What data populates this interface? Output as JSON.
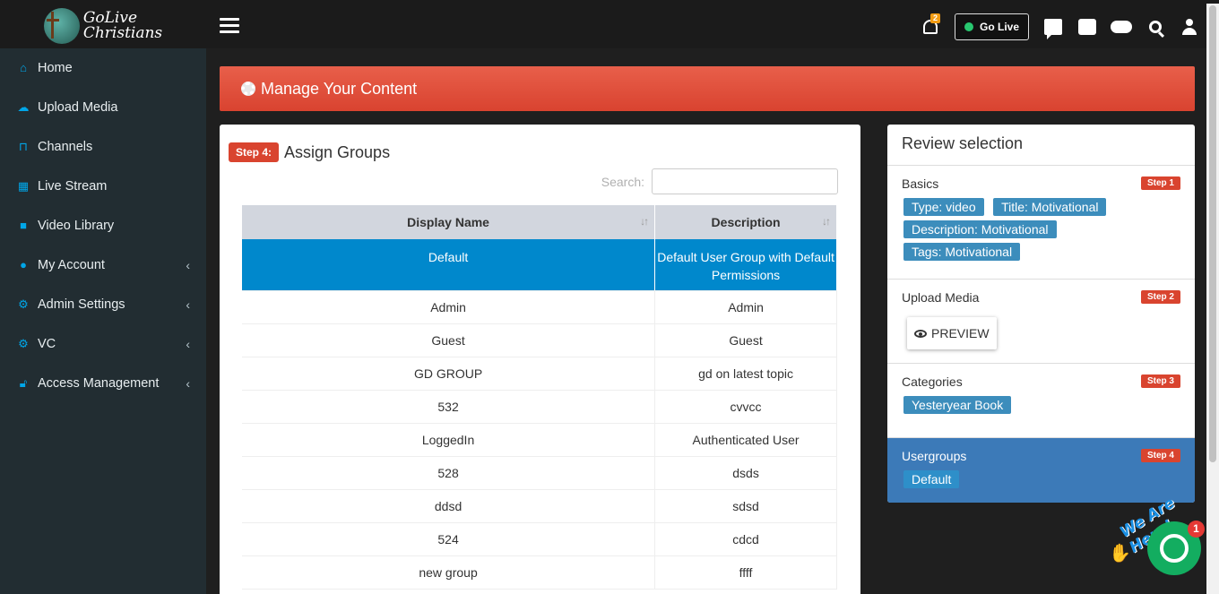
{
  "brand": {
    "line1": "GoLive",
    "line2": "Christians"
  },
  "sidebar": {
    "items": [
      {
        "label": "Home",
        "icon": "home-icon",
        "has_submenu": false
      },
      {
        "label": "Upload Media",
        "icon": "cloud-upload-icon",
        "has_submenu": false
      },
      {
        "label": "Channels",
        "icon": "bookmark-icon",
        "has_submenu": false
      },
      {
        "label": "Live Stream",
        "icon": "calendar-icon",
        "has_submenu": false
      },
      {
        "label": "Video Library",
        "icon": "video-camera-icon",
        "has_submenu": false
      },
      {
        "label": "My Account",
        "icon": "user-icon",
        "has_submenu": true
      },
      {
        "label": "Admin Settings",
        "icon": "cogs-icon",
        "has_submenu": true
      },
      {
        "label": "VC",
        "icon": "cogs-icon",
        "has_submenu": true
      },
      {
        "label": "Access Management",
        "icon": "unlock-icon",
        "has_submenu": true
      }
    ]
  },
  "topbar": {
    "notification_count": "2",
    "go_live_label": "Go Live"
  },
  "page": {
    "title": "Manage Your Content",
    "step_badge": "Step 4:",
    "step_title": "Assign Groups",
    "search_label": "Search:",
    "search_value": ""
  },
  "table": {
    "columns": [
      "Display Name",
      "Description"
    ],
    "rows": [
      {
        "name": "Default",
        "description": "Default User Group with Default Permissions",
        "selected": true
      },
      {
        "name": "Admin",
        "description": "Admin",
        "selected": false
      },
      {
        "name": "Guest",
        "description": "Guest",
        "selected": false
      },
      {
        "name": "GD GROUP",
        "description": "gd on latest topic",
        "selected": false
      },
      {
        "name": "532",
        "description": "cvvcc",
        "selected": false
      },
      {
        "name": "LoggedIn",
        "description": "Authenticated User",
        "selected": false
      },
      {
        "name": "528",
        "description": "dsds",
        "selected": false
      },
      {
        "name": "ddsd",
        "description": "sdsd",
        "selected": false
      },
      {
        "name": "524",
        "description": "cdcd",
        "selected": false
      },
      {
        "name": "new group",
        "description": "ffff",
        "selected": false
      }
    ]
  },
  "review": {
    "title": "Review selection",
    "basics": {
      "title": "Basics",
      "step": "Step 1",
      "tags": [
        "Type: video",
        "Title: Motivational",
        "Description: Motivational",
        "Tags: Motivational"
      ]
    },
    "upload": {
      "title": "Upload Media",
      "step": "Step 2",
      "preview_label": "PREVIEW"
    },
    "categories": {
      "title": "Categories",
      "step": "Step 3",
      "tags": [
        "Yesteryear Book"
      ]
    },
    "usergroups": {
      "title": "Usergroups",
      "step": "Step 4",
      "tags": [
        "Default"
      ]
    }
  },
  "chat_widget": {
    "label": "We Are Here!",
    "unread": "1"
  },
  "colors": {
    "accent_red": "#d9442f",
    "selected_row": "#0088cc",
    "tag_blue": "#3c8dbc",
    "sidebar_bg": "#222d32"
  }
}
